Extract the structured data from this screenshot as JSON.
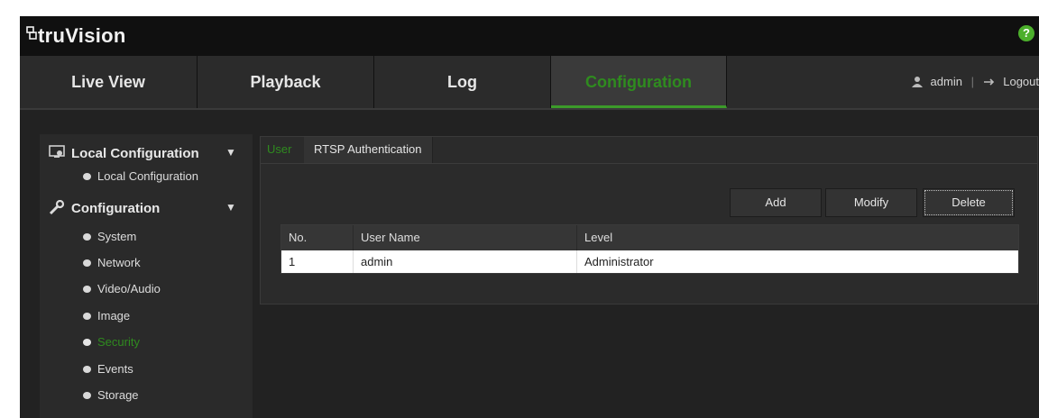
{
  "app": {
    "logo": "truVision",
    "help": "?"
  },
  "nav": {
    "tabs": [
      {
        "label": "Live View"
      },
      {
        "label": "Playback"
      },
      {
        "label": "Log"
      },
      {
        "label": "Configuration",
        "active": true
      }
    ],
    "user": "admin",
    "logout": "Logout"
  },
  "sidebar": {
    "groups": [
      {
        "label": "Local Configuration",
        "icon": "monitor-gear-icon",
        "items": [
          "Local Configuration"
        ]
      },
      {
        "label": "Configuration",
        "icon": "wrench-icon",
        "items": [
          "System",
          "Network",
          "Video/Audio",
          "Image",
          "Security",
          "Events",
          "Storage"
        ]
      }
    ],
    "active_item": "Security"
  },
  "main": {
    "tabs": [
      {
        "label": "User",
        "active": true
      },
      {
        "label": "RTSP Authentication"
      }
    ],
    "buttons": {
      "add": "Add",
      "modify": "Modify",
      "delete": "Delete"
    },
    "table": {
      "columns": [
        "No.",
        "User Name",
        "Level"
      ],
      "rows": [
        [
          "1",
          "admin",
          "Administrator"
        ]
      ]
    }
  },
  "colors": {
    "accent": "#2f8b1f",
    "background": "#1e1e1e",
    "header": "#101010"
  }
}
